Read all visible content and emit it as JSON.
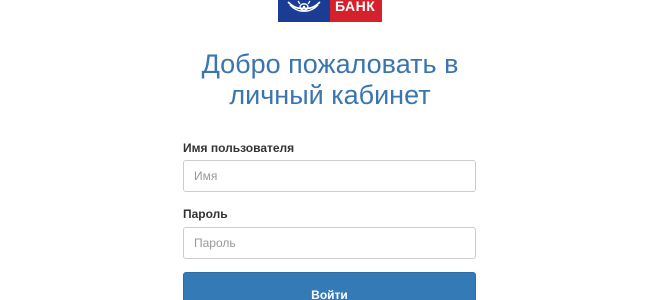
{
  "logo": {
    "bank_word": "БАНК",
    "emblem_icon": "post-horn-emblem-icon",
    "colors": {
      "emblem_bg": "#1a3c94",
      "name_bg": "#d4212c"
    }
  },
  "header": {
    "title_line1": "Добро пожаловать в",
    "title_line2": "личный кабинет",
    "title_color": "#3a75b0"
  },
  "form": {
    "username_label": "Имя пользователя",
    "username_placeholder": "Имя",
    "username_value": "",
    "password_label": "Пароль",
    "password_placeholder": "Пароль",
    "password_value": "",
    "submit_label": "Войти",
    "button_color": "#337ab7"
  }
}
